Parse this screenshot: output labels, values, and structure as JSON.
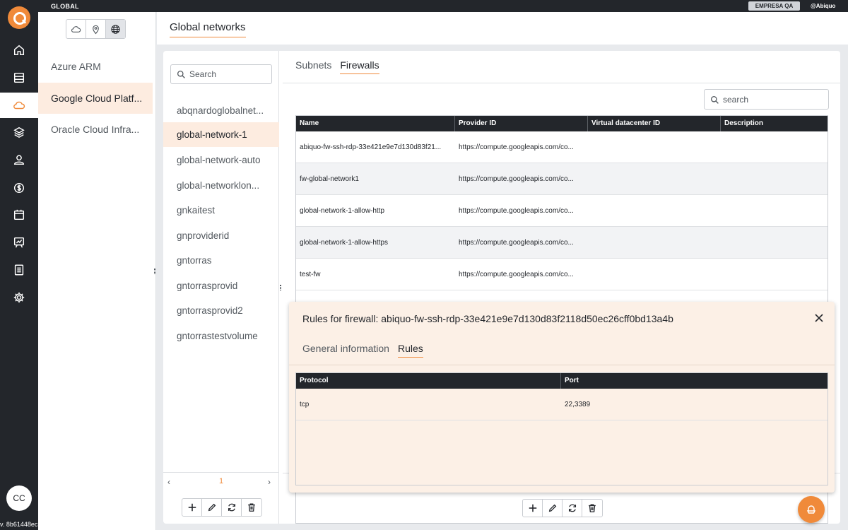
{
  "topbar": {
    "title": "GLOBAL",
    "enterprise": "EMPRESA QA",
    "user": "@Abiquo"
  },
  "leftnav": {
    "items": [
      {
        "icon": "home-icon"
      },
      {
        "icon": "datacenter-icon"
      },
      {
        "icon": "cloud-icon",
        "active": true
      },
      {
        "icon": "layers-icon"
      },
      {
        "icon": "user-icon"
      },
      {
        "icon": "pricing-icon"
      },
      {
        "icon": "calendar-icon"
      },
      {
        "icon": "events-icon"
      },
      {
        "icon": "reports-icon"
      },
      {
        "icon": "settings-icon"
      }
    ],
    "avatar": "CC",
    "version": "v. 8b61448ec"
  },
  "providers": {
    "items": [
      "Azure ARM",
      "Google Cloud Platf...",
      "Oracle Cloud Infra..."
    ],
    "selected": 1
  },
  "page": {
    "title": "Global networks"
  },
  "networks": {
    "search_placeholder": "Search",
    "items": [
      "abqnardoglobalnet...",
      "global-network-1",
      "global-network-auto",
      "global-networklon...",
      "gnkaitest",
      "gnproviderid",
      "gntorras",
      "gntorrasprovid",
      "gntorrasprovid2",
      "gntorrastestvolume"
    ],
    "selected": 1,
    "page": "1",
    "prev": "‹",
    "next": "›"
  },
  "tabs": {
    "subnets": "Subnets",
    "firewalls": "Firewalls"
  },
  "firewalls": {
    "search_placeholder": "search",
    "columns": [
      "Name",
      "Provider ID",
      "Virtual datacenter ID",
      "Description"
    ],
    "rows": [
      [
        "abiquo-fw-ssh-rdp-33e421e9e7d130d83f21...",
        "https://compute.googleapis.com/co...",
        "",
        ""
      ],
      [
        "fw-global-network1",
        "https://compute.googleapis.com/co...",
        "",
        ""
      ],
      [
        "global-network-1-allow-http",
        "https://compute.googleapis.com/co...",
        "",
        ""
      ],
      [
        "global-network-1-allow-https",
        "https://compute.googleapis.com/co...",
        "",
        ""
      ],
      [
        "test-fw",
        "https://compute.googleapis.com/co...",
        "",
        ""
      ]
    ]
  },
  "rules_panel": {
    "title": "Rules for firewall: abiquo-fw-ssh-rdp-33e421e9e7d130d83f2118d50ec26cff0bd13a4b",
    "tabs": {
      "general": "General information",
      "rules": "Rules"
    },
    "columns": [
      "Protocol",
      "Port"
    ],
    "rows": [
      [
        "tcp",
        "22,3389"
      ]
    ]
  },
  "colors": {
    "accent": "#f08a3a",
    "dark": "#23262b",
    "selected_bg": "#fdece0",
    "overlay_bg": "#fcf0e6"
  }
}
